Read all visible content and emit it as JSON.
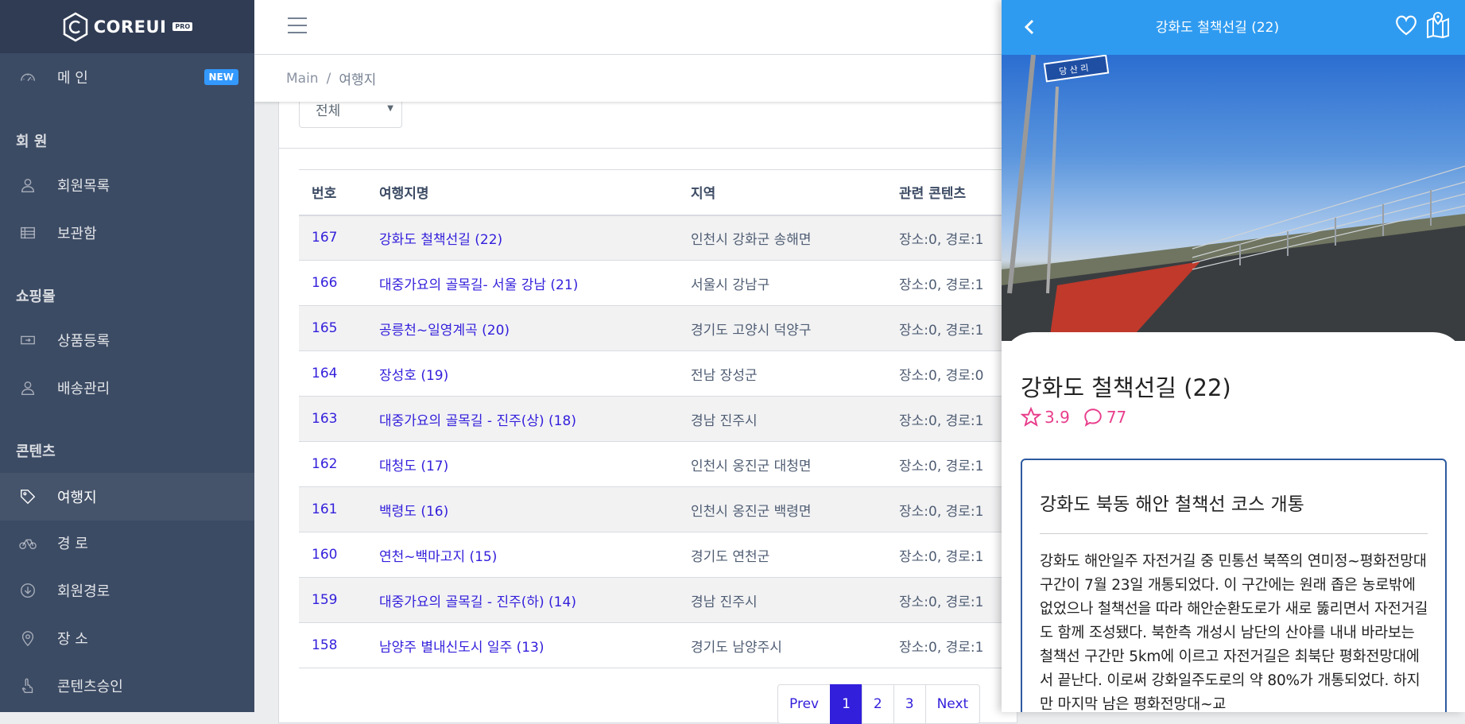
{
  "brand": {
    "name": "COREUI",
    "tag": "PRO"
  },
  "sidebar": {
    "main_item": {
      "label": "메 인",
      "badge": "NEW"
    },
    "sections": [
      {
        "title": "회 원",
        "items": [
          {
            "label": "회원목록"
          },
          {
            "label": "보관함"
          }
        ]
      },
      {
        "title": "쇼핑몰",
        "items": [
          {
            "label": "상품등록"
          },
          {
            "label": "배송관리"
          }
        ]
      },
      {
        "title": "콘텐츠",
        "items": [
          {
            "label": "여행지"
          },
          {
            "label": "경 로"
          },
          {
            "label": "회원경로"
          },
          {
            "label": "장 소"
          },
          {
            "label": "콘텐츠승인"
          }
        ]
      }
    ]
  },
  "breadcrumb": {
    "root": "Main",
    "separator": "/",
    "current": "여행지"
  },
  "filter": {
    "selected": "전체"
  },
  "table": {
    "headers": [
      "번호",
      "여행지명",
      "지역",
      "관련 콘텐츠"
    ],
    "rows": [
      {
        "no": "167",
        "name": "강화도 철책선길 (22)",
        "region": "인천시 강화군 송해면",
        "related": "장소:0, 경로:1"
      },
      {
        "no": "166",
        "name": "대중가요의 골목길- 서울 강남 (21)",
        "region": "서울시 강남구",
        "related": "장소:0, 경로:1"
      },
      {
        "no": "165",
        "name": "공릉천~일영계곡 (20)",
        "region": "경기도 고양시 덕양구",
        "related": "장소:0, 경로:1"
      },
      {
        "no": "164",
        "name": "장성호 (19)",
        "region": "전남 장성군",
        "related": "장소:0, 경로:0"
      },
      {
        "no": "163",
        "name": "대중가요의 골목길 - 진주(상) (18)",
        "region": "경남 진주시",
        "related": "장소:0, 경로:1"
      },
      {
        "no": "162",
        "name": "대청도 (17)",
        "region": "인천시 옹진군 대청면",
        "related": "장소:0, 경로:1"
      },
      {
        "no": "161",
        "name": "백령도 (16)",
        "region": "인천시 옹진군 백령면",
        "related": "장소:0, 경로:1"
      },
      {
        "no": "160",
        "name": "연천~백마고지 (15)",
        "region": "경기도 연천군",
        "related": "장소:0, 경로:1"
      },
      {
        "no": "159",
        "name": "대중가요의 골목길 - 진주(하) (14)",
        "region": "경남 진주시",
        "related": "장소:0, 경로:1"
      },
      {
        "no": "158",
        "name": "남양주 별내신도시 일주 (13)",
        "region": "경기도 남양주시",
        "related": "장소:0, 경로:1"
      }
    ]
  },
  "pagination": {
    "prev": "Prev",
    "pages": [
      "1",
      "2",
      "3"
    ],
    "active": "1",
    "next": "Next"
  },
  "panel": {
    "header_title": "강화도 철책선길 (22)",
    "photo_sign": "당 산 리",
    "title": "강화도 철책선길 (22)",
    "rating": "3.9",
    "comments": "77",
    "article_title": "강화도 북동 해안 철책선 코스 개통",
    "article_body": "강화도 해안일주 자전거길 중 민통선 북쪽의 연미정~평화전망대 구간이 7월 23일 개통되었다. 이 구간에는 원래 좁은 농로밖에 없었으나 철책선을 따라 해안순환도로가 새로 뚫리면서 자전거길도 함께 조성됐다. 북한측 개성시 남단의 산야를 내내 바라보는 철책선 구간만 5km에 이르고 자전거길은 최북단 평화전망대에서 끝난다. 이로써 강화일주도로의 약 80%가 개통되었다. 하지만 마지막 남은 평화전망대~교",
    "accent_color": "#2f9bf0",
    "stat_color": "#e83e8c"
  },
  "colors": {
    "sidebar_bg": "#3c4b64",
    "link": "#321fdb",
    "badge": "#3399ff"
  }
}
